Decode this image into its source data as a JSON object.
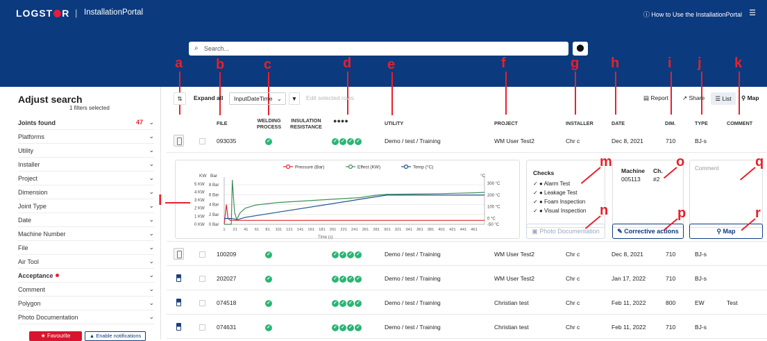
{
  "header": {
    "logo": "LOGSTOR",
    "logo_a": "LOGST",
    "logo_b": "R",
    "separator": "|",
    "portal": "InstallationPortal",
    "howto": "How to Use the InstallationPortal",
    "search_placeholder": "Search..."
  },
  "sidebar": {
    "title": "Adjust search",
    "filters_selected": "1 filters selected",
    "joints_found_label": "Joints found",
    "joints_found_count": "47",
    "items": [
      "Platforms",
      "Utility",
      "Installer",
      "Project",
      "Dimension",
      "Joint Type",
      "Date",
      "Machine Number",
      "File",
      "Air Tool",
      "Acceptance",
      "Comment",
      "Polygon",
      "Photo Documentation"
    ],
    "favourite": "Favourite",
    "notifications": "Enable notifications"
  },
  "toolbar": {
    "expand_all": "Expand all",
    "sort_value": "InputDateTime",
    "edit_rows": "Edit selected rows",
    "report": "Report",
    "share": "Share",
    "list": "List",
    "map": "Map"
  },
  "columns": {
    "file": "FILE",
    "welding": [
      "WELDING",
      "PROCESS"
    ],
    "insulation": [
      "INSULATION",
      "RESISTANCE"
    ],
    "utility": "UTILITY",
    "project": "PROJECT",
    "installer": "INSTALLER",
    "date": "DATE",
    "dim": "DIM.",
    "type": "TYPE",
    "comment": "COMMENT"
  },
  "rows": [
    {
      "file": "093035",
      "utility": "Demo / test / Training",
      "project": "WM User Test2",
      "installer": "Chr c",
      "date": "Dec 8, 2021",
      "dim": "710",
      "type": "BJ-s",
      "comment": ""
    },
    {
      "file": "100209",
      "utility": "Demo / test / Training",
      "project": "WM User Test2",
      "installer": "Chr c",
      "date": "Dec 8, 2021",
      "dim": "710",
      "type": "BJ-s",
      "comment": ""
    },
    {
      "file": "202027",
      "utility": "Demo / test / Training",
      "project": "WM User Test2",
      "installer": "Chr c",
      "date": "Jan 17, 2022",
      "dim": "710",
      "type": "BJ-s",
      "comment": ""
    },
    {
      "file": "074518",
      "utility": "Demo / test / Training",
      "project": "Christian test",
      "installer": "Chr c",
      "date": "Feb 11, 2022",
      "dim": "800",
      "type": "EW",
      "comment": "Test"
    },
    {
      "file": "074631",
      "utility": "Demo / test / Training",
      "project": "Christian test",
      "installer": "Chr c",
      "date": "Feb 11, 2022",
      "dim": "710",
      "type": "BJ-s",
      "comment": ""
    }
  ],
  "detail": {
    "checks_title": "Checks",
    "checks": [
      "Alarm Test",
      "Leakage Test",
      "Foam Inspection",
      "Visual Inspection"
    ],
    "machine_label": "Machine",
    "machine_value": "005113",
    "ch_label": "Ch.",
    "ch_value": "#2",
    "comment_placeholder": "Comment",
    "photo_btn": "Photo Documentation",
    "corrective_btn": "Corrective actions",
    "map_btn": "Map"
  },
  "annotations": [
    "a",
    "b",
    "c",
    "d",
    "e",
    "f",
    "g",
    "h",
    "i",
    "j",
    "k",
    "l",
    "m",
    "n",
    "o",
    "p",
    "q",
    "r"
  ],
  "colors": {
    "header": "#0b3a7e",
    "accent_red": "#e8202a",
    "ok_green": "#2bb574",
    "pressure": "#e3262e",
    "effect": "#3f8f57",
    "temp": "#1d4f8f"
  },
  "chart_data": {
    "type": "line",
    "legend": [
      "Pressure (Bar)",
      "Effect (KW)",
      "Temp (°C)"
    ],
    "left_axis_kw": [
      "5 KW",
      "4 KW",
      "3 KW",
      "2 KW",
      "1 KW",
      "0 KW"
    ],
    "left_axis_bar": [
      "8 Bar",
      "6 Bar",
      "4 Bar",
      "2 Bar",
      "0 Bar"
    ],
    "right_axis": [
      "300 °C",
      "200 °C",
      "100 °C",
      "0 °C",
      "-50 °C"
    ],
    "axis_titles": {
      "kw": "KW",
      "bar": "Bar",
      "c": "°C",
      "x": "Time (s)"
    },
    "x_ticks": [
      "1",
      "21",
      "41",
      "61",
      "81",
      "101",
      "121",
      "141",
      "161",
      "181",
      "201",
      "221",
      "241",
      "261",
      "281",
      "301",
      "321",
      "341",
      "361",
      "381",
      "401",
      "421",
      "441",
      "461"
    ],
    "xlim": [
      1,
      480
    ],
    "series": [
      {
        "name": "Pressure (Bar)",
        "axis": "bar",
        "x": [
          1,
          5,
          8,
          12,
          20,
          480
        ],
        "y": [
          0,
          4,
          1.2,
          0.8,
          0.8,
          0.8
        ]
      },
      {
        "name": "Effect (KW)",
        "axis": "kw",
        "x": [
          1,
          14,
          16,
          20,
          24,
          30,
          40,
          60,
          100,
          200,
          250,
          280,
          300,
          350,
          400,
          430,
          460,
          480
        ],
        "y": [
          0,
          0,
          5.5,
          1.5,
          0.6,
          1.4,
          2.0,
          2.4,
          2.7,
          3.1,
          3.3,
          3.6,
          3.7,
          3.75,
          3.8,
          3.85,
          3.9,
          3.95
        ]
      },
      {
        "name": "Temp (°C)",
        "axis": "c",
        "x": [
          1,
          15,
          25,
          40,
          300,
          480
        ],
        "y": [
          0,
          0,
          -10,
          10,
          200,
          200
        ]
      }
    ]
  }
}
